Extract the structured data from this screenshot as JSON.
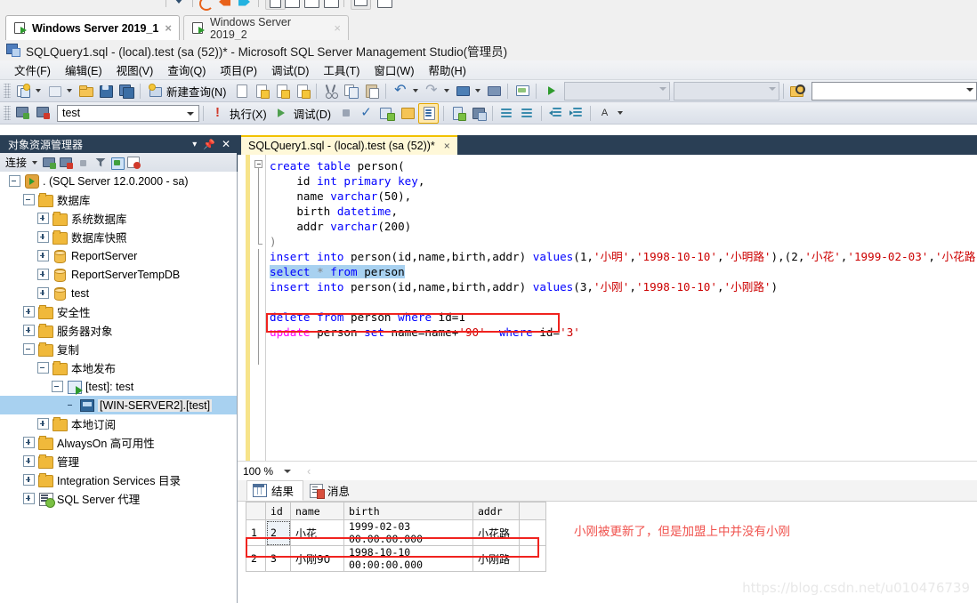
{
  "window_tabs": [
    {
      "label": "Windows Server 2019_1",
      "icon": "server-icon",
      "active": true,
      "close": "×"
    },
    {
      "label": "Windows Server 2019_2",
      "icon": "server-icon",
      "active": false,
      "close": "×"
    }
  ],
  "app": {
    "title": "SQLQuery1.sql - (local).test (sa (52))* - Microsoft SQL Server Management Studio(管理员)",
    "icon": "ssms-icon"
  },
  "menu": {
    "items": [
      "文件(F)",
      "编辑(E)",
      "视图(V)",
      "查询(Q)",
      "项目(P)",
      "调试(D)",
      "工具(T)",
      "窗口(W)",
      "帮助(H)"
    ]
  },
  "toolbar_standard": {
    "new_query_label": "新建查询(N)"
  },
  "toolbar_sql": {
    "database_value": "test",
    "execute_label": "执行(X)",
    "debug_label": "调试(D)",
    "find_placeholder": ""
  },
  "object_explorer": {
    "title": "对象资源管理器",
    "connect_label": "连接",
    "tree": [
      {
        "label": ". (SQL Server 12.0.2000 - sa)",
        "icon": "server-instance-icon",
        "indent": 0,
        "state": "expanded"
      },
      {
        "label": "数据库",
        "icon": "folder-icon",
        "indent": 1,
        "state": "expanded"
      },
      {
        "label": "系统数据库",
        "icon": "folder-icon",
        "indent": 2,
        "state": "collapsed"
      },
      {
        "label": "数据库快照",
        "icon": "folder-icon",
        "indent": 2,
        "state": "collapsed"
      },
      {
        "label": "ReportServer",
        "icon": "database-icon",
        "indent": 2,
        "state": "collapsed"
      },
      {
        "label": "ReportServerTempDB",
        "icon": "database-icon",
        "indent": 2,
        "state": "collapsed"
      },
      {
        "label": "test",
        "icon": "database-icon",
        "indent": 2,
        "state": "collapsed"
      },
      {
        "label": "安全性",
        "icon": "folder-icon",
        "indent": 1,
        "state": "collapsed"
      },
      {
        "label": "服务器对象",
        "icon": "folder-icon",
        "indent": 1,
        "state": "collapsed"
      },
      {
        "label": "复制",
        "icon": "folder-icon",
        "indent": 1,
        "state": "expanded"
      },
      {
        "label": "本地发布",
        "icon": "folder-icon",
        "indent": 2,
        "state": "expanded"
      },
      {
        "label": "[test]: test",
        "icon": "publication-icon",
        "indent": 3,
        "state": "expanded"
      },
      {
        "label": "[WIN-SERVER2].[test]",
        "icon": "subscription-icon",
        "indent": 4,
        "state": "leaf",
        "selected": true
      },
      {
        "label": "本地订阅",
        "icon": "folder-icon",
        "indent": 2,
        "state": "collapsed"
      },
      {
        "label": "AlwaysOn 高可用性",
        "icon": "folder-icon",
        "indent": 1,
        "state": "collapsed"
      },
      {
        "label": "管理",
        "icon": "folder-icon",
        "indent": 1,
        "state": "collapsed"
      },
      {
        "label": "Integration Services 目录",
        "icon": "folder-icon",
        "indent": 1,
        "state": "collapsed"
      },
      {
        "label": "SQL Server 代理",
        "icon": "sql-agent-icon",
        "indent": 1,
        "state": "collapsed"
      }
    ]
  },
  "document_tab": {
    "label": "SQLQuery1.sql - (local).test (sa (52))*",
    "close": "×"
  },
  "editor": {
    "lines": [
      [
        {
          "t": "create",
          "c": "kw"
        },
        {
          "t": " ",
          "c": ""
        },
        {
          "t": "table",
          "c": "kw"
        },
        {
          "t": " person(",
          "c": ""
        }
      ],
      [
        {
          "t": "    id ",
          "c": ""
        },
        {
          "t": "int",
          "c": "kw"
        },
        {
          "t": " ",
          "c": ""
        },
        {
          "t": "primary",
          "c": "kw"
        },
        {
          "t": " ",
          "c": ""
        },
        {
          "t": "key",
          "c": "kw"
        },
        {
          "t": ",",
          "c": ""
        }
      ],
      [
        {
          "t": "    name ",
          "c": ""
        },
        {
          "t": "varchar",
          "c": "kw"
        },
        {
          "t": "(50),",
          "c": ""
        }
      ],
      [
        {
          "t": "    birth ",
          "c": ""
        },
        {
          "t": "datetime",
          "c": "kw"
        },
        {
          "t": ",",
          "c": ""
        }
      ],
      [
        {
          "t": "    addr ",
          "c": ""
        },
        {
          "t": "varchar",
          "c": "kw"
        },
        {
          "t": "(200)",
          "c": ""
        }
      ],
      [
        {
          "t": ")",
          "c": "gray"
        }
      ],
      [
        {
          "t": "insert",
          "c": "kw"
        },
        {
          "t": " ",
          "c": ""
        },
        {
          "t": "into",
          "c": "kw"
        },
        {
          "t": " person(id,name,birth,addr) ",
          "c": ""
        },
        {
          "t": "values",
          "c": "kw"
        },
        {
          "t": "(1,",
          "c": ""
        },
        {
          "t": "'小明'",
          "c": "str"
        },
        {
          "t": ",",
          "c": ""
        },
        {
          "t": "'1998-10-10'",
          "c": "str"
        },
        {
          "t": ",",
          "c": ""
        },
        {
          "t": "'小明路'",
          "c": "str"
        },
        {
          "t": "),(2,",
          "c": ""
        },
        {
          "t": "'小花'",
          "c": "str"
        },
        {
          "t": ",",
          "c": ""
        },
        {
          "t": "'1999-02-03'",
          "c": "str"
        },
        {
          "t": ",",
          "c": ""
        },
        {
          "t": "'小花路'",
          "c": "str"
        },
        {
          "t": ")",
          "c": ""
        }
      ],
      [
        {
          "t": "select",
          "c": "kw sel"
        },
        {
          "t": " ",
          "c": "sel"
        },
        {
          "t": "*",
          "c": "gray sel"
        },
        {
          "t": " ",
          "c": "sel"
        },
        {
          "t": "from",
          "c": "kw sel"
        },
        {
          "t": " person",
          "c": "sel"
        }
      ],
      [
        {
          "t": "insert",
          "c": "kw"
        },
        {
          "t": " ",
          "c": ""
        },
        {
          "t": "into",
          "c": "kw"
        },
        {
          "t": " person(id,name,birth,addr) ",
          "c": ""
        },
        {
          "t": "values",
          "c": "kw"
        },
        {
          "t": "(3,",
          "c": ""
        },
        {
          "t": "'小刚'",
          "c": "str"
        },
        {
          "t": ",",
          "c": ""
        },
        {
          "t": "'1998-10-10'",
          "c": "str"
        },
        {
          "t": ",",
          "c": ""
        },
        {
          "t": "'小刚路'",
          "c": "str"
        },
        {
          "t": ")",
          "c": ""
        }
      ],
      [
        {
          "t": "",
          "c": ""
        }
      ],
      [
        {
          "t": "delete",
          "c": "kw"
        },
        {
          "t": " ",
          "c": ""
        },
        {
          "t": "from",
          "c": "kw"
        },
        {
          "t": " person ",
          "c": ""
        },
        {
          "t": "where",
          "c": "kw"
        },
        {
          "t": " id=1",
          "c": ""
        }
      ],
      [
        {
          "t": "update",
          "c": "mag"
        },
        {
          "t": " person ",
          "c": ""
        },
        {
          "t": "set",
          "c": "kw"
        },
        {
          "t": " name=name+",
          "c": ""
        },
        {
          "t": "'90'",
          "c": "str"
        },
        {
          "t": "  ",
          "c": ""
        },
        {
          "t": "where",
          "c": "kw"
        },
        {
          "t": " id=",
          "c": ""
        },
        {
          "t": "'3'",
          "c": "str"
        }
      ]
    ]
  },
  "zoom_bar": {
    "zoom_value": "100 %"
  },
  "results": {
    "tabs": [
      {
        "label": "结果",
        "icon": "grid-icon",
        "active": true
      },
      {
        "label": "消息",
        "icon": "message-icon",
        "active": false
      }
    ],
    "columns": [
      "id",
      "name",
      "birth",
      "addr"
    ],
    "rows": [
      {
        "num": "1",
        "cells": [
          "2",
          "小花",
          "1999-02-03 00:00:00.000",
          "小花路"
        ]
      },
      {
        "num": "2",
        "cells": [
          "3",
          "小刚90",
          "1998-10-10 00:00:00.000",
          "小刚路"
        ]
      }
    ],
    "annotation": "小刚被更新了，但是加盟上中并没有小刚"
  },
  "watermark": "https://blog.csdn.net/u010476739",
  "colors": {
    "accent_dark": "#2a3f55",
    "tab_yellow": "#fff8d8",
    "highlight_red": "#f0231f",
    "annotation_red": "#f0524d",
    "keyword_blue": "#0000ff",
    "string_red": "#cc0000",
    "update_magenta": "#ff00ff",
    "selection_blue": "#a8d1f0"
  }
}
